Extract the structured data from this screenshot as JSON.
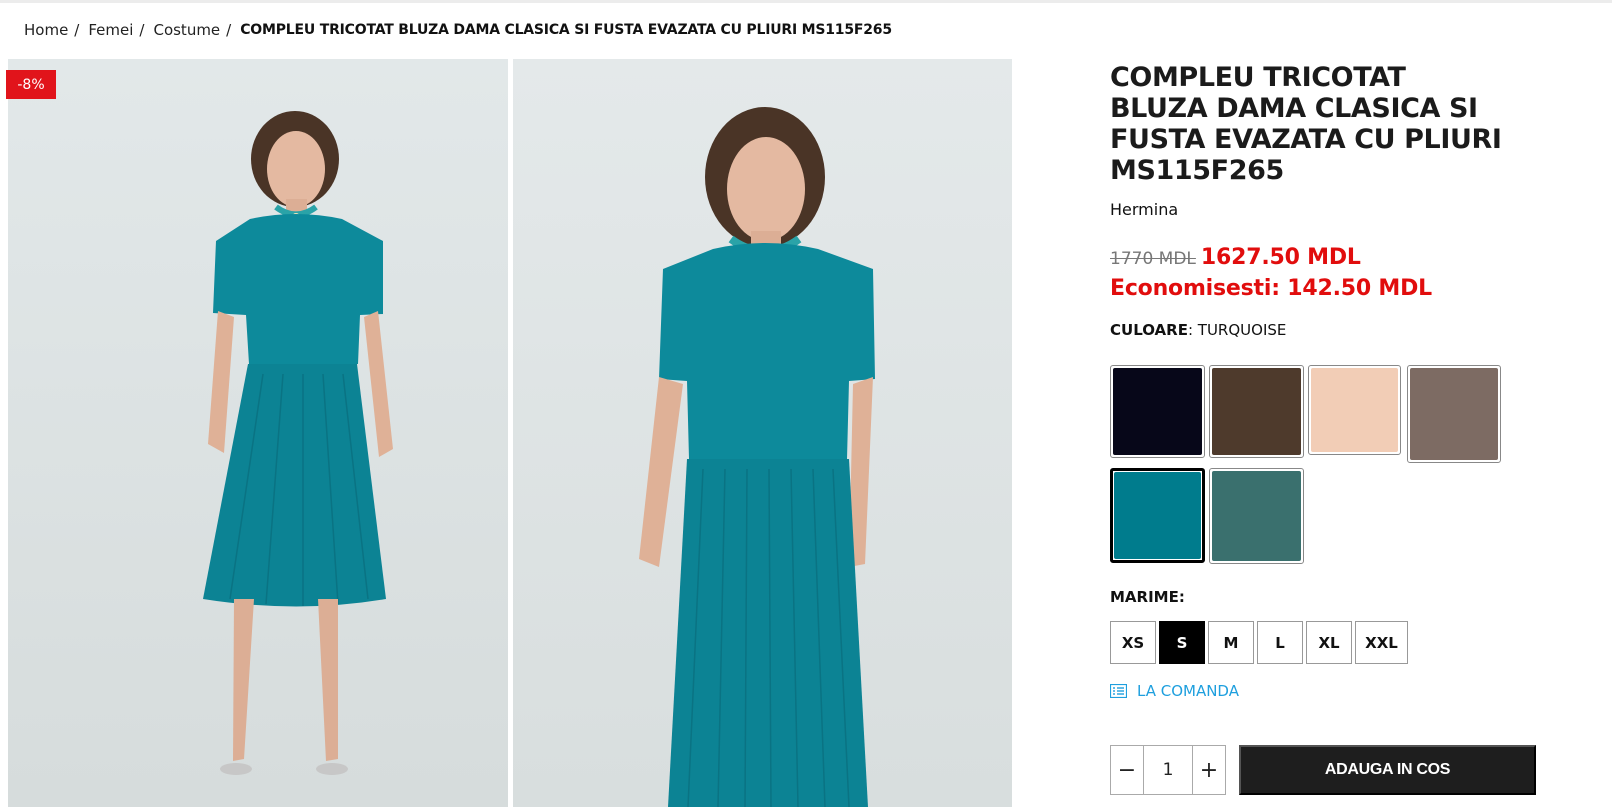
{
  "breadcrumb": {
    "items": [
      "Home",
      "Femei",
      "Costume"
    ],
    "current": "COMPLEU TRICOTAT BLUZA DAMA CLASICA SI FUSTA EVAZATA CU PLIURI MS115F265"
  },
  "gallery": {
    "discount_badge": "-8%"
  },
  "product": {
    "title": "COMPLEU TRICOTAT BLUZA DAMA CLASICA SI FUSTA EVAZATA CU PLIURI MS115F265",
    "brand": "Hermina",
    "old_price": "1770 MDL",
    "new_price": "1627.50 MDL",
    "savings": "Economisesti: 142.50 MDL"
  },
  "color": {
    "label": "CULOARE",
    "value": ": TURQUOISE",
    "swatches": [
      {
        "name": "navy",
        "hex": "#070719"
      },
      {
        "name": "brown",
        "hex": "#4e3a2c"
      },
      {
        "name": "beige",
        "hex": "#f2cdb6"
      },
      {
        "name": "taupe",
        "hex": "#7d6b63"
      },
      {
        "name": "turquoise",
        "hex": "#007c8d",
        "selected": true
      },
      {
        "name": "teal-green",
        "hex": "#3a706e"
      }
    ]
  },
  "size": {
    "label": "MARIME",
    "suffix": ":",
    "options": [
      "XS",
      "S",
      "M",
      "L",
      "XL",
      "XXL"
    ],
    "selected": "S"
  },
  "order_link": "LA COMANDA",
  "quantity": {
    "value": "1",
    "minus": "−",
    "plus": "+"
  },
  "add_to_cart": "ADAUGA IN COS"
}
